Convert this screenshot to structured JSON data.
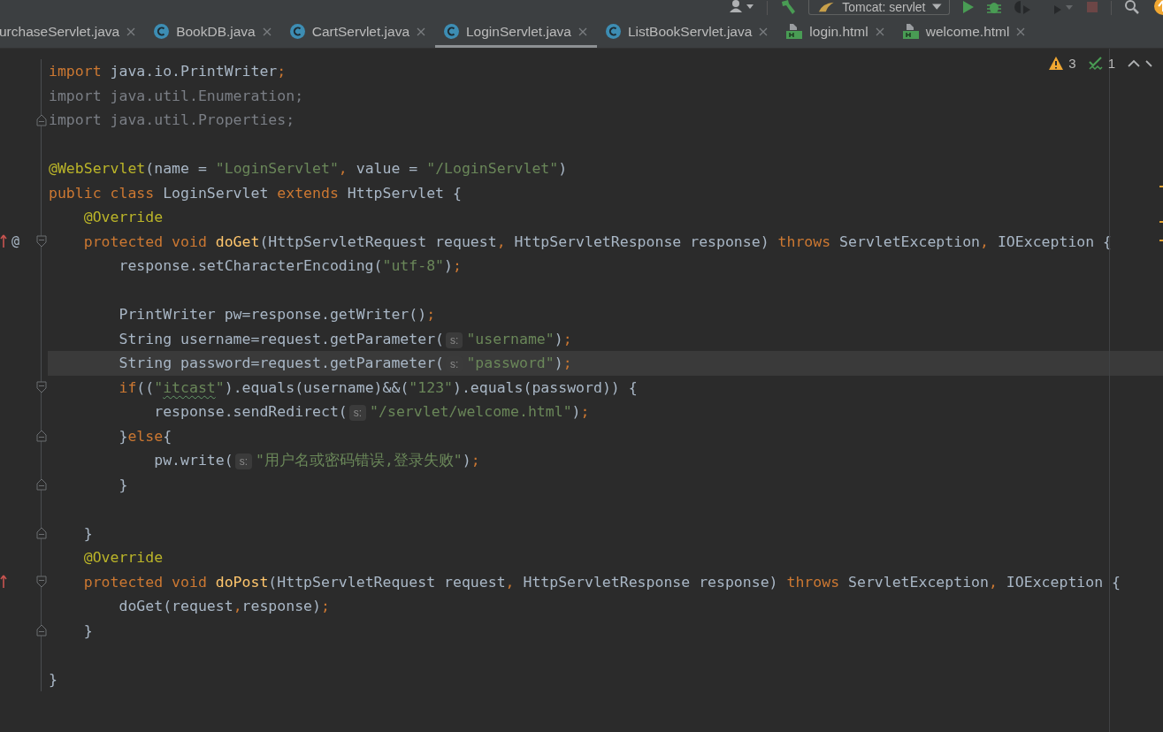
{
  "toolbar": {
    "buttons": [
      {
        "kind": "user",
        "disabled": false
      },
      {
        "kind": "build",
        "disabled": false
      },
      {
        "kind": "run-config",
        "label": "Tomcat: servlet",
        "disabled": false
      },
      {
        "kind": "run",
        "disabled": false
      },
      {
        "kind": "debug",
        "disabled": false
      },
      {
        "kind": "coverage",
        "disabled": true
      },
      {
        "kind": "profile",
        "disabled": true
      },
      {
        "kind": "stop",
        "disabled": true
      },
      {
        "kind": "search",
        "disabled": false
      },
      {
        "kind": "update",
        "disabled": false
      }
    ]
  },
  "tabs": [
    {
      "kind": "clipped",
      "label": "urchaseServlet.java",
      "selected": false
    },
    {
      "kind": "java",
      "label": "BookDB.java",
      "selected": false
    },
    {
      "kind": "java",
      "label": "CartServlet.java",
      "selected": false
    },
    {
      "kind": "java",
      "label": "LoginServlet.java",
      "selected": true
    },
    {
      "kind": "java",
      "label": "ListBookServlet.java",
      "selected": false
    },
    {
      "kind": "html",
      "label": "login.html",
      "selected": false
    },
    {
      "kind": "html",
      "label": "welcome.html",
      "selected": false
    }
  ],
  "inspections": {
    "warnings": "3",
    "typos": "1"
  },
  "lines": [
    {
      "current": false,
      "fold_start": false,
      "fold_end": false,
      "tokens": [
        {
          "kind": "kw",
          "text": "import "
        },
        {
          "kind": "plain",
          "text": "java.io.PrintWriter"
        },
        {
          "kind": "kw",
          "text": ";"
        }
      ]
    },
    {
      "current": false,
      "fold_start": false,
      "fold_end": false,
      "tokens": [
        {
          "kind": "unused",
          "text": "import java.util.Enumeration;"
        }
      ]
    },
    {
      "current": false,
      "fold_start": false,
      "fold_end": true,
      "tokens": [
        {
          "kind": "unused",
          "text": "import java.util.Properties;"
        }
      ]
    },
    {
      "current": false,
      "fold_start": false,
      "fold_end": false
    },
    {
      "current": false,
      "fold_start": false,
      "fold_end": false,
      "tokens": [
        {
          "kind": "ann",
          "text": "@WebServlet"
        },
        {
          "kind": "plain",
          "text": "(name = "
        },
        {
          "kind": "str",
          "text": "\"LoginServlet\""
        },
        {
          "kind": "kw",
          "text": ", "
        },
        {
          "kind": "plain",
          "text": "value = "
        },
        {
          "kind": "str",
          "text": "\"/LoginServlet\""
        },
        {
          "kind": "plain",
          "text": ")"
        }
      ]
    },
    {
      "current": false,
      "fold_start": false,
      "fold_end": false,
      "tokens": [
        {
          "kind": "kw",
          "text": "public class "
        },
        {
          "kind": "plain",
          "text": "LoginServlet "
        },
        {
          "kind": "kw",
          "text": "extends "
        },
        {
          "kind": "plain",
          "text": "HttpServlet {"
        }
      ]
    },
    {
      "current": false,
      "fold_start": false,
      "fold_end": false,
      "tokens": [
        {
          "kind": "ann",
          "text": "    @Override"
        }
      ]
    },
    {
      "current": false,
      "fold_start": true,
      "fold_end": false,
      "gutter": [
        {
          "kind": "overrides"
        },
        {
          "kind": "symbol",
          "text": "@"
        }
      ],
      "tokens": [
        {
          "kind": "kw",
          "text": "    protected void "
        },
        {
          "kind": "fn",
          "text": "doGet"
        },
        {
          "kind": "plain",
          "text": "(HttpServletRequest request"
        },
        {
          "kind": "kw",
          "text": ", "
        },
        {
          "kind": "plain",
          "text": "HttpServletResponse response) "
        },
        {
          "kind": "kw",
          "text": "throws "
        },
        {
          "kind": "plain",
          "text": "ServletException"
        },
        {
          "kind": "kw",
          "text": ", "
        },
        {
          "kind": "plain",
          "text": "IOException {"
        }
      ]
    },
    {
      "current": false,
      "fold_start": false,
      "fold_end": false,
      "tokens": [
        {
          "kind": "plain",
          "text": "        response.setCharacterEncoding("
        },
        {
          "kind": "str",
          "text": "\"utf-8\""
        },
        {
          "kind": "plain",
          "text": ")"
        },
        {
          "kind": "kw",
          "text": ";"
        }
      ]
    },
    {
      "current": false,
      "fold_start": false,
      "fold_end": false
    },
    {
      "current": false,
      "fold_start": false,
      "fold_end": false,
      "tokens": [
        {
          "kind": "plain",
          "text": "        PrintWriter pw=response.getWriter()"
        },
        {
          "kind": "kw",
          "text": ";"
        }
      ]
    },
    {
      "current": false,
      "fold_start": false,
      "fold_end": false,
      "tokens": [
        {
          "kind": "plain",
          "text": "        String username=request.getParameter("
        },
        {
          "kind": "hint",
          "text": "s:"
        },
        {
          "kind": "str",
          "text": "\"username\""
        },
        {
          "kind": "plain",
          "text": ")"
        },
        {
          "kind": "kw",
          "text": ";"
        }
      ]
    },
    {
      "current": true,
      "fold_start": false,
      "fold_end": false,
      "tokens": [
        {
          "kind": "plain",
          "text": "        String password=request.getParameter("
        },
        {
          "kind": "hint",
          "text": "s:"
        },
        {
          "kind": "str",
          "text": "\"password\""
        },
        {
          "kind": "plain",
          "text": ")"
        },
        {
          "kind": "kw",
          "text": ";"
        }
      ]
    },
    {
      "current": false,
      "fold_start": true,
      "fold_end": false,
      "tokens": [
        {
          "kind": "kw",
          "text": "        if"
        },
        {
          "kind": "plain",
          "text": "(("
        },
        {
          "kind": "str",
          "text": "\""
        },
        {
          "kind": "typo",
          "text": "itcast"
        },
        {
          "kind": "str",
          "text": "\""
        },
        {
          "kind": "plain",
          "text": ").equals(username)&&("
        },
        {
          "kind": "str",
          "text": "\"123\""
        },
        {
          "kind": "plain",
          "text": ").equals(password)) {"
        }
      ]
    },
    {
      "current": false,
      "fold_start": false,
      "fold_end": false,
      "tokens": [
        {
          "kind": "plain",
          "text": "            response.sendRedirect("
        },
        {
          "kind": "hint",
          "text": "s:"
        },
        {
          "kind": "str",
          "text": "\"/servlet/welcome.html\""
        },
        {
          "kind": "plain",
          "text": ")"
        },
        {
          "kind": "kw",
          "text": ";"
        }
      ]
    },
    {
      "current": false,
      "fold_start": false,
      "fold_end": true,
      "tokens": [
        {
          "kind": "plain",
          "text": "        }"
        },
        {
          "kind": "kw",
          "text": "else"
        },
        {
          "kind": "plain",
          "text": "{"
        }
      ]
    },
    {
      "current": false,
      "fold_start": false,
      "fold_end": false,
      "tokens": [
        {
          "kind": "plain",
          "text": "            pw.write("
        },
        {
          "kind": "hint",
          "text": "s:"
        },
        {
          "kind": "str",
          "text": "\"用户名或密码错误,登录失败\""
        },
        {
          "kind": "plain",
          "text": ")"
        },
        {
          "kind": "kw",
          "text": ";"
        }
      ]
    },
    {
      "current": false,
      "fold_start": false,
      "fold_end": true,
      "tokens": [
        {
          "kind": "plain",
          "text": "        }"
        }
      ]
    },
    {
      "current": false,
      "fold_start": false,
      "fold_end": false
    },
    {
      "current": false,
      "fold_start": false,
      "fold_end": true,
      "tokens": [
        {
          "kind": "plain",
          "text": "    }"
        }
      ]
    },
    {
      "current": false,
      "fold_start": false,
      "fold_end": false,
      "tokens": [
        {
          "kind": "ann",
          "text": "    @Override"
        }
      ]
    },
    {
      "current": false,
      "fold_start": true,
      "fold_end": false,
      "gutter": [
        {
          "kind": "overrides"
        }
      ],
      "tokens": [
        {
          "kind": "kw",
          "text": "    protected void "
        },
        {
          "kind": "fn",
          "text": "doPost"
        },
        {
          "kind": "plain",
          "text": "(HttpServletRequest request"
        },
        {
          "kind": "kw",
          "text": ", "
        },
        {
          "kind": "plain",
          "text": "HttpServletResponse response) "
        },
        {
          "kind": "kw",
          "text": "throws "
        },
        {
          "kind": "plain",
          "text": "ServletException"
        },
        {
          "kind": "kw",
          "text": ", "
        },
        {
          "kind": "plain",
          "text": "IOException {"
        }
      ]
    },
    {
      "current": false,
      "fold_start": false,
      "fold_end": false,
      "tokens": [
        {
          "kind": "plain",
          "text": "        doGet(request"
        },
        {
          "kind": "kw",
          "text": ","
        },
        {
          "kind": "plain",
          "text": "response)"
        },
        {
          "kind": "kw",
          "text": ";"
        }
      ]
    },
    {
      "current": false,
      "fold_start": false,
      "fold_end": true,
      "tokens": [
        {
          "kind": "plain",
          "text": "    }"
        }
      ]
    },
    {
      "current": false,
      "fold_start": false,
      "fold_end": false
    },
    {
      "current": false,
      "fold_start": false,
      "fold_end": false,
      "tokens": [
        {
          "kind": "plain",
          "text": "}"
        }
      ]
    }
  ]
}
